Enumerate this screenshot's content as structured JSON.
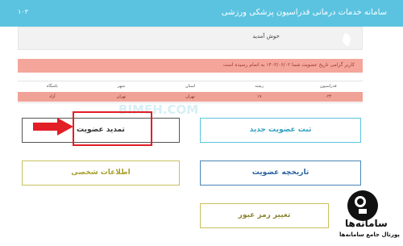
{
  "header": {
    "title": "سامانه خدمات درمانی فدراسیون پزشکی ورزشی",
    "version": "۱۰۳"
  },
  "welcome": {
    "text": "خوش آمدید"
  },
  "alert": {
    "text": "کاربر گرامی تاریخ عضویت شما ۱۴۰۳/۰۶/۰۲ به اتمام رسیده است"
  },
  "info_table": {
    "headers": [
      "فدراسیون",
      "رشته",
      "استان",
      "شهر",
      "باشگاه"
    ],
    "row": [
      "۰۲۴",
      "۱۹",
      "تهران",
      "تهران",
      "آزاد"
    ]
  },
  "buttons": {
    "register_new": "ثبت عضویت جدید",
    "renew": "تمدید عضویت",
    "history": "تاریخچه عضویت",
    "profile": "اطلاعات شخصی",
    "change_password": "تغییر رمز عبور"
  },
  "watermark": "BIMEH.COM",
  "logo": {
    "name": "سامانه‌ها",
    "tagline": "پورتال جامع سامانه‌ها"
  },
  "colors": {
    "header": "#5bc3e0",
    "alert": "#f4a69a",
    "highlight": "#e21e26"
  }
}
